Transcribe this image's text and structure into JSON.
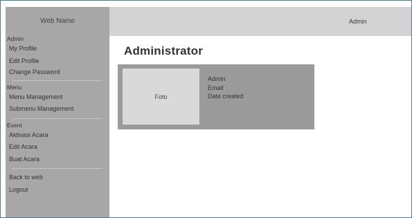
{
  "sidebar": {
    "brand": "Web Name",
    "sections": [
      {
        "heading": "Admin",
        "items": [
          "My Profile",
          "Edit Profile",
          "Change Password"
        ]
      },
      {
        "heading": "Menu",
        "items": [
          "Menu Management",
          "Submenu Management"
        ]
      },
      {
        "heading": "Event",
        "items": [
          "Aktivasi Acara",
          "Edit Acara",
          "Buat Acara"
        ]
      },
      {
        "heading": "",
        "items": [
          "Back to web",
          "Logout"
        ]
      }
    ]
  },
  "topbar": {
    "user": "Admin"
  },
  "main": {
    "title": "Administrator",
    "card": {
      "photo_label": "Foto",
      "name": "Admin",
      "email": "Email",
      "date_created": "Date created"
    }
  },
  "colors": {
    "sidebar_bg": "#a7a7a7",
    "topbar_bg": "#d3d3d3",
    "card_bg": "#9b9b9b",
    "photo_bg": "#d9d9d9",
    "frame_border": "#4b7a8c"
  }
}
